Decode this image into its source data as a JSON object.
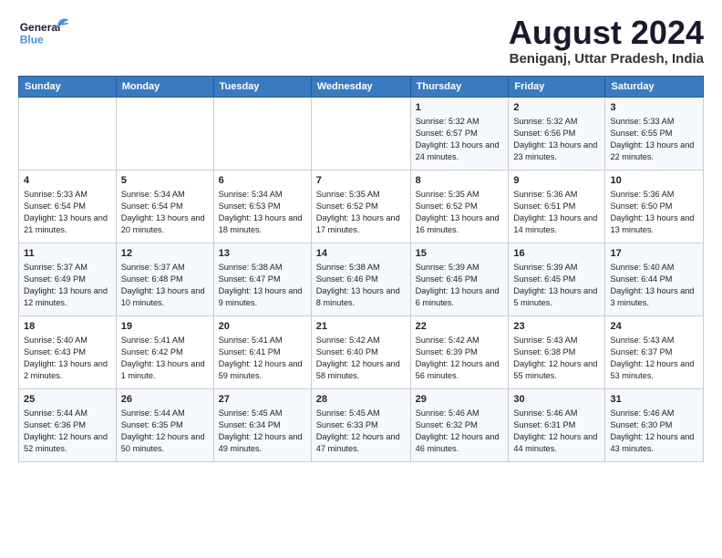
{
  "header": {
    "logo_general": "General",
    "logo_blue": "Blue",
    "title": "August 2024",
    "location": "Beniganj, Uttar Pradesh, India"
  },
  "days_of_week": [
    "Sunday",
    "Monday",
    "Tuesday",
    "Wednesday",
    "Thursday",
    "Friday",
    "Saturday"
  ],
  "weeks": [
    [
      {
        "day": "",
        "info": ""
      },
      {
        "day": "",
        "info": ""
      },
      {
        "day": "",
        "info": ""
      },
      {
        "day": "",
        "info": ""
      },
      {
        "day": "1",
        "info": "Sunrise: 5:32 AM\nSunset: 6:57 PM\nDaylight: 13 hours\nand 24 minutes."
      },
      {
        "day": "2",
        "info": "Sunrise: 5:32 AM\nSunset: 6:56 PM\nDaylight: 13 hours\nand 23 minutes."
      },
      {
        "day": "3",
        "info": "Sunrise: 5:33 AM\nSunset: 6:55 PM\nDaylight: 13 hours\nand 22 minutes."
      }
    ],
    [
      {
        "day": "4",
        "info": "Sunrise: 5:33 AM\nSunset: 6:54 PM\nDaylight: 13 hours\nand 21 minutes."
      },
      {
        "day": "5",
        "info": "Sunrise: 5:34 AM\nSunset: 6:54 PM\nDaylight: 13 hours\nand 20 minutes."
      },
      {
        "day": "6",
        "info": "Sunrise: 5:34 AM\nSunset: 6:53 PM\nDaylight: 13 hours\nand 18 minutes."
      },
      {
        "day": "7",
        "info": "Sunrise: 5:35 AM\nSunset: 6:52 PM\nDaylight: 13 hours\nand 17 minutes."
      },
      {
        "day": "8",
        "info": "Sunrise: 5:35 AM\nSunset: 6:52 PM\nDaylight: 13 hours\nand 16 minutes."
      },
      {
        "day": "9",
        "info": "Sunrise: 5:36 AM\nSunset: 6:51 PM\nDaylight: 13 hours\nand 14 minutes."
      },
      {
        "day": "10",
        "info": "Sunrise: 5:36 AM\nSunset: 6:50 PM\nDaylight: 13 hours\nand 13 minutes."
      }
    ],
    [
      {
        "day": "11",
        "info": "Sunrise: 5:37 AM\nSunset: 6:49 PM\nDaylight: 13 hours\nand 12 minutes."
      },
      {
        "day": "12",
        "info": "Sunrise: 5:37 AM\nSunset: 6:48 PM\nDaylight: 13 hours\nand 10 minutes."
      },
      {
        "day": "13",
        "info": "Sunrise: 5:38 AM\nSunset: 6:47 PM\nDaylight: 13 hours\nand 9 minutes."
      },
      {
        "day": "14",
        "info": "Sunrise: 5:38 AM\nSunset: 6:46 PM\nDaylight: 13 hours\nand 8 minutes."
      },
      {
        "day": "15",
        "info": "Sunrise: 5:39 AM\nSunset: 6:46 PM\nDaylight: 13 hours\nand 6 minutes."
      },
      {
        "day": "16",
        "info": "Sunrise: 5:39 AM\nSunset: 6:45 PM\nDaylight: 13 hours\nand 5 minutes."
      },
      {
        "day": "17",
        "info": "Sunrise: 5:40 AM\nSunset: 6:44 PM\nDaylight: 13 hours\nand 3 minutes."
      }
    ],
    [
      {
        "day": "18",
        "info": "Sunrise: 5:40 AM\nSunset: 6:43 PM\nDaylight: 13 hours\nand 2 minutes."
      },
      {
        "day": "19",
        "info": "Sunrise: 5:41 AM\nSunset: 6:42 PM\nDaylight: 13 hours\nand 1 minute."
      },
      {
        "day": "20",
        "info": "Sunrise: 5:41 AM\nSunset: 6:41 PM\nDaylight: 12 hours\nand 59 minutes."
      },
      {
        "day": "21",
        "info": "Sunrise: 5:42 AM\nSunset: 6:40 PM\nDaylight: 12 hours\nand 58 minutes."
      },
      {
        "day": "22",
        "info": "Sunrise: 5:42 AM\nSunset: 6:39 PM\nDaylight: 12 hours\nand 56 minutes."
      },
      {
        "day": "23",
        "info": "Sunrise: 5:43 AM\nSunset: 6:38 PM\nDaylight: 12 hours\nand 55 minutes."
      },
      {
        "day": "24",
        "info": "Sunrise: 5:43 AM\nSunset: 6:37 PM\nDaylight: 12 hours\nand 53 minutes."
      }
    ],
    [
      {
        "day": "25",
        "info": "Sunrise: 5:44 AM\nSunset: 6:36 PM\nDaylight: 12 hours\nand 52 minutes."
      },
      {
        "day": "26",
        "info": "Sunrise: 5:44 AM\nSunset: 6:35 PM\nDaylight: 12 hours\nand 50 minutes."
      },
      {
        "day": "27",
        "info": "Sunrise: 5:45 AM\nSunset: 6:34 PM\nDaylight: 12 hours\nand 49 minutes."
      },
      {
        "day": "28",
        "info": "Sunrise: 5:45 AM\nSunset: 6:33 PM\nDaylight: 12 hours\nand 47 minutes."
      },
      {
        "day": "29",
        "info": "Sunrise: 5:46 AM\nSunset: 6:32 PM\nDaylight: 12 hours\nand 46 minutes."
      },
      {
        "day": "30",
        "info": "Sunrise: 5:46 AM\nSunset: 6:31 PM\nDaylight: 12 hours\nand 44 minutes."
      },
      {
        "day": "31",
        "info": "Sunrise: 5:46 AM\nSunset: 6:30 PM\nDaylight: 12 hours\nand 43 minutes."
      }
    ]
  ]
}
